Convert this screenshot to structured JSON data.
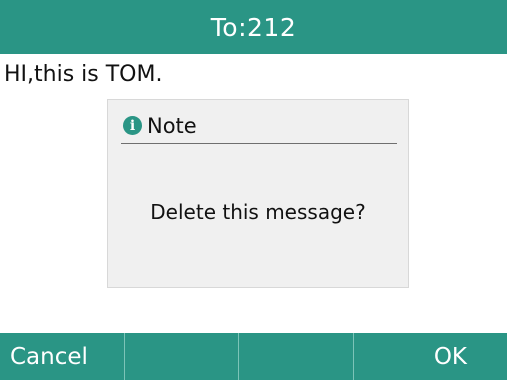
{
  "header": {
    "title": "To:212"
  },
  "message": {
    "text": "HI,this is TOM."
  },
  "dialog": {
    "icon": "info-icon",
    "title": "Note",
    "body": "Delete this message?"
  },
  "softkeys": [
    {
      "label": "Cancel"
    },
    {
      "label": ""
    },
    {
      "label": ""
    },
    {
      "label": "OK"
    }
  ],
  "colors": {
    "accent": "#2a9585",
    "dialog_background": "#f0f0f0"
  }
}
